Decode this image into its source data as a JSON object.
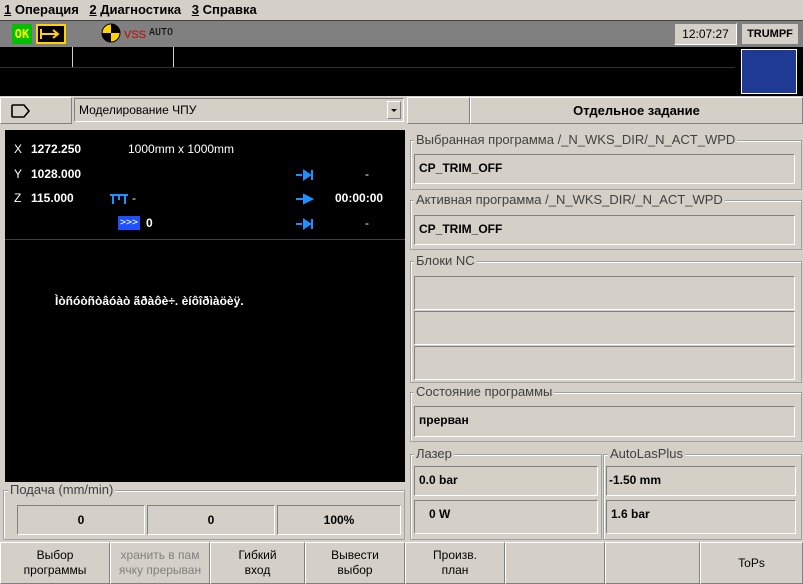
{
  "menu": [
    {
      "num": "1",
      "label": " Операция"
    },
    {
      "num": "2",
      "label": " Диагностика"
    },
    {
      "num": "3",
      "label": " Справка"
    }
  ],
  "toolbar": {
    "ok_label": "OK",
    "vss_label": "VSS",
    "mode_label": "AUTO",
    "time": "12:07:27",
    "brand": "TRUMPF"
  },
  "mode_bar": {
    "program_select": "Моделирование ЧПУ",
    "job_title": "Отдельное задание"
  },
  "position": {
    "x_axis": "X",
    "x_value": "1272.250",
    "sheet_size": "1000mm x 1000mm",
    "y_axis": "Y",
    "y_value": "1028.000",
    "y_right": "-",
    "z_axis": "Z",
    "z_value": "115.000",
    "z_mid": "-",
    "z_time": "00:00:00",
    "count_value": "0",
    "count_right": "-"
  },
  "message": "Ìòñóòñòâóàò ãðàôè÷. èíôîðìàöèÿ.",
  "feed": {
    "title": "Подача (mm/min)",
    "values": [
      "0",
      "0",
      "100%"
    ]
  },
  "selected_program": {
    "title": "Выбранная программа /_N_WKS_DIR/_N_ACT_WPD",
    "value": "CP_TRIM_OFF"
  },
  "active_program": {
    "title": "Активная программа /_N_WKS_DIR/_N_ACT_WPD",
    "value": "CP_TRIM_OFF"
  },
  "nc_blocks": {
    "title": "Блоки NC",
    "rows": [
      "",
      "",
      ""
    ]
  },
  "program_state": {
    "title": "Состояние программы",
    "value": "прерван"
  },
  "laser": {
    "title": "Лазер",
    "pressure": "0.0 bar",
    "power": "0 W"
  },
  "autolas": {
    "title": "AutoLasPlus",
    "distance": "-1.50 mm",
    "pressure": "1.6 bar"
  },
  "softkeys": [
    {
      "line1": "Выбор",
      "line2": "программы"
    },
    {
      "line1": "хранить в пам",
      "line2": "ячку прерыван"
    },
    {
      "line1": "Гибкий",
      "line2": "вход"
    },
    {
      "line1": "Вывести",
      "line2": "выбор"
    },
    {
      "line1": "Произв.",
      "line2": "план"
    },
    {
      "line1": "",
      "line2": ""
    },
    {
      "line1": "",
      "line2": ""
    },
    {
      "line1": "ToPs",
      "line2": ""
    }
  ],
  "colors": {
    "ok_bg": "#00c000",
    "vss": "#c00000",
    "brand_block": "#1f3a93",
    "panel_dark": "#000000"
  }
}
